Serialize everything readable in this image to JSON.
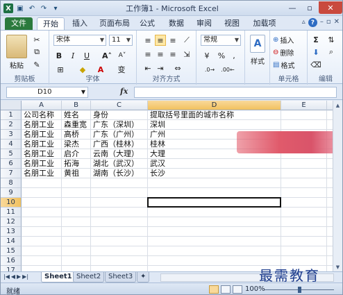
{
  "window": {
    "title": "工作簿1 - Microsoft Excel",
    "logo_letter": "X"
  },
  "qat": {
    "save_icon": "save-icon",
    "undo_icon": "undo-icon",
    "redo_icon": "redo-icon"
  },
  "tabs": [
    {
      "label": "文件"
    },
    {
      "label": "开始"
    },
    {
      "label": "插入"
    },
    {
      "label": "页面布局"
    },
    {
      "label": "公式"
    },
    {
      "label": "数据"
    },
    {
      "label": "审阅"
    },
    {
      "label": "视图"
    },
    {
      "label": "加载项"
    }
  ],
  "ribbon": {
    "clipboard": {
      "label": "剪贴板",
      "paste": "粘贴"
    },
    "font": {
      "label": "字体",
      "name": "宋体",
      "size": "11",
      "bold": "B",
      "italic": "I",
      "underline": "U"
    },
    "alignment": {
      "label": "对齐方式"
    },
    "number": {
      "label": "数字",
      "format": "常规",
      "percent": "%",
      "comma": ","
    },
    "styles": {
      "label": "样式",
      "button": "样式",
      "icon": "A"
    },
    "cells": {
      "label": "单元格",
      "insert": "插入",
      "delete": "删除",
      "format": "格式"
    },
    "editing": {
      "label": "编辑",
      "sum": "Σ"
    }
  },
  "formula_bar": {
    "name_box": "D10",
    "fx": "fx",
    "value": ""
  },
  "grid": {
    "columns": [
      "A",
      "B",
      "C",
      "D",
      "E"
    ],
    "rows": [
      "1",
      "2",
      "3",
      "4",
      "5",
      "6",
      "7",
      "8",
      "9",
      "10",
      "11",
      "12",
      "13",
      "14",
      "15",
      "16",
      "17"
    ],
    "cells": [
      [
        "公司名称",
        "姓名",
        "身份",
        "提取括号里面的城市名称"
      ],
      [
        "名朋工业",
        "森重宽",
        "广东（深圳）",
        "深圳"
      ],
      [
        "名朋工业",
        "高桥",
        "广东（广州）",
        "广州"
      ],
      [
        "名朋工业",
        "梁杰",
        "广西（桂林）",
        "桂林"
      ],
      [
        "名朋工业",
        "启介",
        "云南（大理）",
        "大理"
      ],
      [
        "名朋工业",
        "拓海",
        "湖北（武汉）",
        "武汉"
      ],
      [
        "名朋工业",
        "黄祖",
        "湖南（长沙）",
        "长沙"
      ]
    ],
    "selected_col": "D",
    "selected_row": "10"
  },
  "sheets": [
    "Sheet1",
    "Sheet2",
    "Sheet3"
  ],
  "status": {
    "ready": "就绪",
    "zoom": "100%"
  },
  "watermark": "最需教育"
}
